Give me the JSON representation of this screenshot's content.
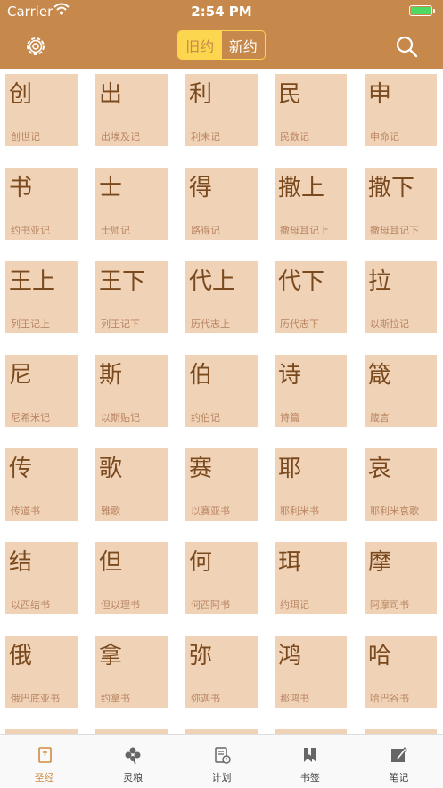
{
  "status": {
    "carrier": "Carrier",
    "time": "2:54 PM",
    "battery_level": 1.0
  },
  "nav": {
    "tab_old": "旧约",
    "tab_new": "新约",
    "active_tab": "旧约"
  },
  "colors": {
    "accent": "#c6894b",
    "tile": "#f0d2b7",
    "segment": "#fbd64e",
    "tab_active": "#d08a3e"
  },
  "books": [
    {
      "short": "创",
      "full": "创世记"
    },
    {
      "short": "出",
      "full": "出埃及记"
    },
    {
      "short": "利",
      "full": "利未记"
    },
    {
      "short": "民",
      "full": "民数记"
    },
    {
      "short": "申",
      "full": "申命记"
    },
    {
      "short": "书",
      "full": "约书亚记"
    },
    {
      "short": "士",
      "full": "士师记"
    },
    {
      "short": "得",
      "full": "路得记"
    },
    {
      "short": "撒上",
      "full": "撒母耳记上"
    },
    {
      "short": "撒下",
      "full": "撒母耳记下"
    },
    {
      "short": "王上",
      "full": "列王记上"
    },
    {
      "short": "王下",
      "full": "列王记下"
    },
    {
      "short": "代上",
      "full": "历代志上"
    },
    {
      "short": "代下",
      "full": "历代志下"
    },
    {
      "short": "拉",
      "full": "以斯拉记"
    },
    {
      "short": "尼",
      "full": "尼希米记"
    },
    {
      "short": "斯",
      "full": "以斯贴记"
    },
    {
      "short": "伯",
      "full": "约伯记"
    },
    {
      "short": "诗",
      "full": "诗篇"
    },
    {
      "short": "箴",
      "full": "箴言"
    },
    {
      "short": "传",
      "full": "传道书"
    },
    {
      "short": "歌",
      "full": "雅歌"
    },
    {
      "short": "赛",
      "full": "以赛亚书"
    },
    {
      "short": "耶",
      "full": "耶利米书"
    },
    {
      "short": "哀",
      "full": "耶利米哀歌"
    },
    {
      "short": "结",
      "full": "以西结书"
    },
    {
      "short": "但",
      "full": "但以理书"
    },
    {
      "short": "何",
      "full": "何西阿书"
    },
    {
      "short": "珥",
      "full": "约珥记"
    },
    {
      "short": "摩",
      "full": "阿摩司书"
    },
    {
      "short": "俄",
      "full": "俄巴底亚书"
    },
    {
      "short": "拿",
      "full": "约拿书"
    },
    {
      "short": "弥",
      "full": "弥迦书"
    },
    {
      "short": "鸿",
      "full": "那鸿书"
    },
    {
      "short": "哈",
      "full": "哈巴谷书"
    },
    {
      "short": "",
      "full": ""
    },
    {
      "short": "",
      "full": ""
    },
    {
      "short": "",
      "full": ""
    },
    {
      "short": "",
      "full": ""
    },
    {
      "short": "",
      "full": ""
    }
  ],
  "tabbar": [
    {
      "label": "圣经",
      "icon": "bible-icon",
      "active": true
    },
    {
      "label": "灵粮",
      "icon": "clover-icon",
      "active": false
    },
    {
      "label": "计划",
      "icon": "plan-clipboard-icon",
      "active": false
    },
    {
      "label": "书签",
      "icon": "bookmark-icon",
      "active": false
    },
    {
      "label": "笔记",
      "icon": "note-edit-icon",
      "active": false
    }
  ]
}
